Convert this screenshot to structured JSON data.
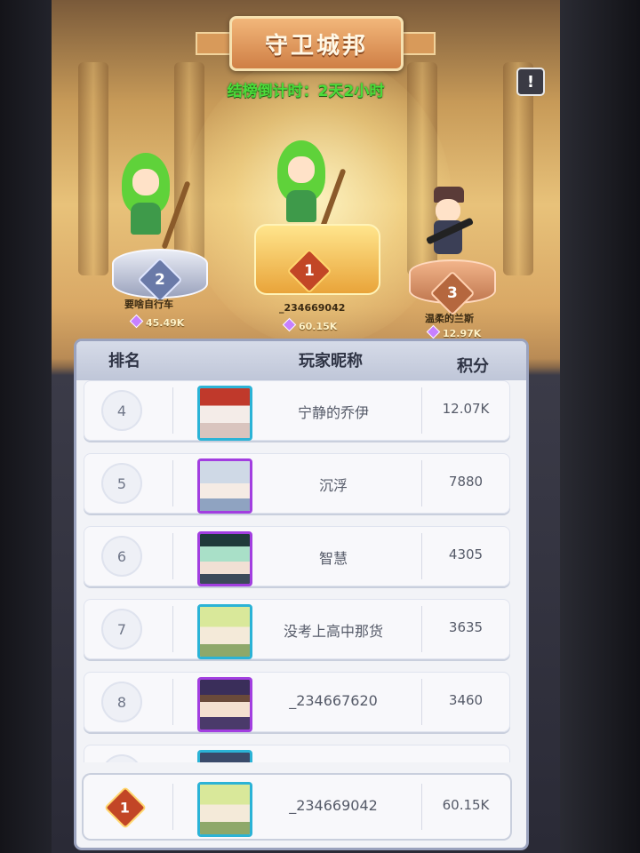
{
  "header": {
    "title": "守卫城邦",
    "countdown": "结榜倒计时：2天2小时",
    "info_icon": "exclamation-icon"
  },
  "podium": [
    {
      "rank": "2",
      "name": "要啥自行车",
      "score": "45.49K",
      "medal_color": "#6a7aa8"
    },
    {
      "rank": "1",
      "name": "_234669042",
      "score": "60.15K",
      "medal_color": "#c24626"
    },
    {
      "rank": "3",
      "name": "温柔的兰斯",
      "score": "12.97K",
      "medal_color": "#b5673e"
    }
  ],
  "table": {
    "headers": {
      "rank": "排名",
      "name": "玩家昵称",
      "score": "积分"
    },
    "rows": [
      {
        "rank": "4",
        "name": "宁静的乔伊",
        "score": "12.07K",
        "frame": "blue"
      },
      {
        "rank": "5",
        "name": "沉浮",
        "score": "7880",
        "frame": "purple"
      },
      {
        "rank": "6",
        "name": "智慧",
        "score": "4305",
        "frame": "purple"
      },
      {
        "rank": "7",
        "name": "没考上高中那货",
        "score": "3635",
        "frame": "blue"
      },
      {
        "rank": "8",
        "name": "_234667620",
        "score": "3460",
        "frame": "purple"
      }
    ]
  },
  "self_row": {
    "rank": "1",
    "name": "_234669042",
    "score": "60.15K"
  },
  "colors": {
    "countdown": "#4bdc3a",
    "frame_blue": "#2bb3d6",
    "frame_purple": "#a23ee0"
  }
}
